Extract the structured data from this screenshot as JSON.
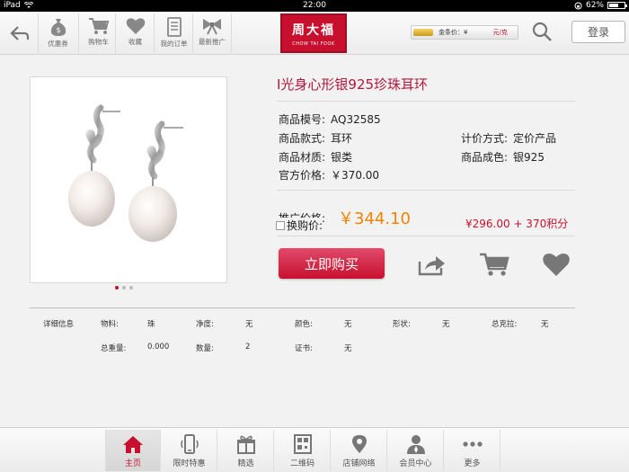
{
  "status": {
    "device": "iPad",
    "time": "22:00",
    "battery": "62%",
    "battery_level": 0.62
  },
  "nav": {
    "buttons": [
      {
        "label": "优惠券",
        "icon": "money-bag-icon"
      },
      {
        "label": "购物车",
        "icon": "cart-icon"
      },
      {
        "label": "收藏",
        "icon": "heart-icon"
      },
      {
        "label": "我的订单",
        "icon": "orders-icon"
      },
      {
        "label": "最新推广",
        "icon": "bow-icon"
      }
    ],
    "logo_cn": "周大福",
    "logo_en": "CHOW TAI FOOK",
    "gold_price_label": "金条价：¥",
    "gold_price_unit": "元/克",
    "login": "登录"
  },
  "product": {
    "title": "I光身心形银925珍珠耳环",
    "specs": [
      {
        "k": "商品模号:",
        "v": "AQ32585"
      },
      {
        "k": "商品款式:",
        "v": "耳环"
      },
      {
        "k": "商品材质:",
        "v": "银类"
      },
      {
        "k": "官方价格:",
        "v": "￥370.00"
      }
    ],
    "specs_right": [
      {
        "k": "计价方式:",
        "v": "定价产品"
      },
      {
        "k": "商品成色:",
        "v": "银925"
      }
    ],
    "promo_label": "推广价格:",
    "promo_price": "￥344.10",
    "member_label": "换购价:",
    "points_price": "¥296.00 + 370积分",
    "buy_label": "立即购买"
  },
  "details": {
    "row1": [
      {
        "k": "详细信息",
        "v": ""
      },
      {
        "k": "物料:",
        "v": "珠"
      },
      {
        "k": "净度:",
        "v": "无"
      },
      {
        "k": "颜色:",
        "v": "无"
      },
      {
        "k": "形状:",
        "v": "无"
      },
      {
        "k": "总克拉:",
        "v": "无"
      }
    ],
    "row2": [
      {
        "k": "总重量:",
        "v": "0.000"
      },
      {
        "k": "数量:",
        "v": "2"
      },
      {
        "k": "证书:",
        "v": "无"
      }
    ]
  },
  "tabs": [
    {
      "label": "主页",
      "icon": "home-icon"
    },
    {
      "label": "限时特惠",
      "icon": "phone-icon"
    },
    {
      "label": "精选",
      "icon": "gift-icon"
    },
    {
      "label": "二维码",
      "icon": "qr-icon"
    },
    {
      "label": "店铺网络",
      "icon": "location-icon"
    },
    {
      "label": "会员中心",
      "icon": "person-icon"
    },
    {
      "label": "更多",
      "icon": "more-icon"
    }
  ],
  "colors": {
    "brand": "#c8102e",
    "promo": "#f08300",
    "title": "#b5163a"
  }
}
